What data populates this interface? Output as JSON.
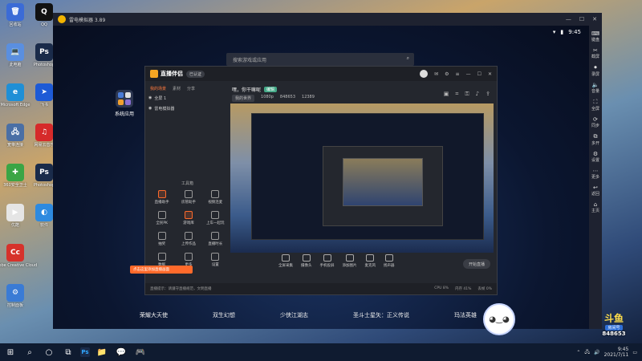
{
  "desktop": {
    "icons": [
      {
        "label": "回收站",
        "color": "#3b6bd6",
        "glyph": "🗑"
      },
      {
        "label": "此电脑",
        "color": "#5a8fe0",
        "glyph": "💻"
      },
      {
        "label": "Microsoft Edge",
        "color": "#1f8fd6",
        "glyph": "e"
      },
      {
        "label": "宽带连接",
        "color": "#4a6fa5",
        "glyph": "🖧"
      },
      {
        "label": "360安全卫士",
        "color": "#3ba545",
        "glyph": "✚"
      },
      {
        "label": "优酷",
        "color": "#e5e5e5",
        "glyph": "▶"
      },
      {
        "label": "Adobe Creative Cloud",
        "color": "#d6322b",
        "glyph": "Cc"
      },
      {
        "label": "控制面板",
        "color": "#3a7bd5",
        "glyph": "⚙"
      },
      {
        "label": "QQ",
        "color": "#111111",
        "glyph": "Q"
      },
      {
        "label": "Photoshop",
        "color": "#1a2b4a",
        "glyph": "Ps"
      },
      {
        "label": "飞书",
        "color": "#1d5ad6",
        "glyph": "➤"
      },
      {
        "label": "网易云音乐",
        "color": "#d62a2a",
        "glyph": "♫"
      },
      {
        "label": "Photoshop",
        "color": "#1a2b4a",
        "glyph": "Ps"
      },
      {
        "label": "软件",
        "color": "#2d8ae0",
        "glyph": "◐"
      }
    ]
  },
  "emulator": {
    "title": "雷电模拟器 3.89",
    "status": {
      "time": "9:45"
    },
    "search_placeholder": "搜索游戏或应用",
    "system_app_label": "系统应用",
    "games": [
      "荣耀大天使",
      "双生幻想",
      "少侠江湖志",
      "圣斗士星矢：正义传说",
      "玛法英雄"
    ],
    "right_bar": [
      "键盘",
      "截屏",
      "录屏",
      "音量",
      "全屏",
      "同步",
      "多开",
      "设置",
      "更多",
      "返回",
      "主页"
    ]
  },
  "live": {
    "app_name": "直播伴侣",
    "badge": "已认证",
    "tabs": [
      "我的场景",
      "素材",
      "分享"
    ],
    "scenes": [
      "全屏 1",
      "雷电模拟器"
    ],
    "stream_title": "嘿，你干嘛呢",
    "stream_tag": "编辑",
    "category": "我的世界",
    "resolution": "1080p",
    "room": "848653",
    "viewers": "12389",
    "tools_title": "工具箱",
    "tools": [
      "直播助手",
      "房管助手",
      "视频连麦",
      "全民PK",
      "游戏库",
      "上车一起玩",
      "抽奖",
      "上传作品",
      "直播时长",
      "数据",
      "更多",
      "设置"
    ],
    "bottom_tools": [
      "全屏采集",
      "摄像头",
      "手机投屏",
      "添加图片",
      "麦克风",
      "扬声器"
    ],
    "start_label": "开始直播",
    "status_left": "直播提示：请遵守直播规范，文明直播",
    "status_right": [
      "CPU 8%",
      "内存 41%",
      "丢帧 0%"
    ],
    "toast": "点击这里添加直播画面"
  },
  "overlay": {
    "douyu_logo": "斗鱼",
    "room_label": "房间号",
    "room_id": "848653"
  },
  "taskbar": {
    "date": "2021/7/11",
    "apps": [
      "Ps",
      "📁",
      "💬",
      "🎮"
    ]
  }
}
